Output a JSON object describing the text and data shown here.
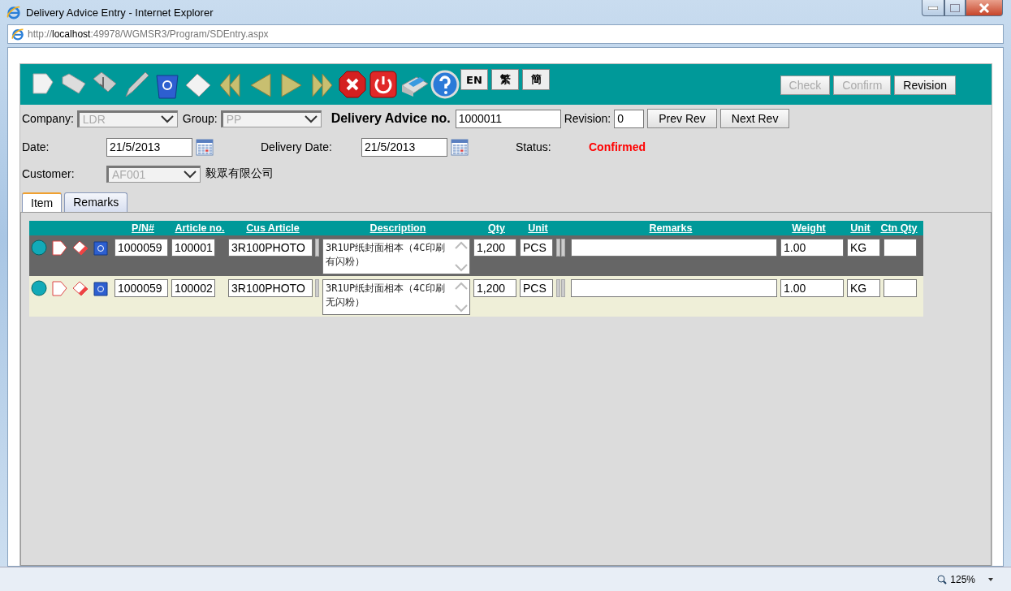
{
  "window": {
    "title": "Delivery Advice Entry - Internet Explorer"
  },
  "address": {
    "url": "http://**localhost**:49978/WGMSR3/Program/SDEntry.aspx"
  },
  "toolbar": {
    "language_buttons": [
      "EN",
      "繁",
      "簡"
    ],
    "action_buttons": [
      {
        "label": "Check",
        "disabled": true
      },
      {
        "label": "Confirm",
        "disabled": true
      },
      {
        "label": "Revision",
        "disabled": false
      }
    ]
  },
  "form": {
    "company": {
      "label": "Company:",
      "value": "LDR",
      "disabled": true
    },
    "group": {
      "label": "Group:",
      "value": "PP",
      "disabled": true
    },
    "doc_no": {
      "label": "Delivery Advice no.",
      "value": "1000011"
    },
    "revision": {
      "label": "Revision:",
      "value": "0"
    },
    "rev_buttons": [
      "Prev Rev",
      "Next Rev"
    ],
    "date": {
      "label": "Date:",
      "value": "21/5/2013"
    },
    "delivery_date": {
      "label": "Delivery Date:",
      "value": "21/5/2013"
    },
    "status": {
      "label": "Status:",
      "value": "Confirmed"
    },
    "customer": {
      "label": "Customer:",
      "value": "AF001",
      "disabled": true,
      "name": "毅眾有限公司"
    }
  },
  "tabs": [
    {
      "label": "Item",
      "selected": true
    },
    {
      "label": "Remarks",
      "selected": false
    }
  ],
  "table": {
    "columns": [
      "P/N#",
      "Article no.",
      "Cus Article",
      "Description",
      "Qty",
      "Unit",
      "Remarks",
      "Weight",
      "Unit",
      "Ctn Qty"
    ],
    "rows": [
      {
        "selected": true,
        "pn": "1000059",
        "article": "100001",
        "cus_article": "3R100PHOTO",
        "description": "3R1UP纸封面相本（4C印刷有闪粉）",
        "qty": "1,200",
        "unit": "PCS",
        "weight": "1.00",
        "weight_unit": "KG"
      },
      {
        "selected": false,
        "pn": "1000059",
        "article": "100002",
        "cus_article": "3R100PHOTO",
        "description": "3R1UP纸封面相本（4C印刷无闪粉）",
        "qty": "1,200",
        "unit": "PCS",
        "weight": "1.00",
        "weight_unit": "KG"
      }
    ]
  },
  "status_bar": {
    "zoom": "125%"
  }
}
